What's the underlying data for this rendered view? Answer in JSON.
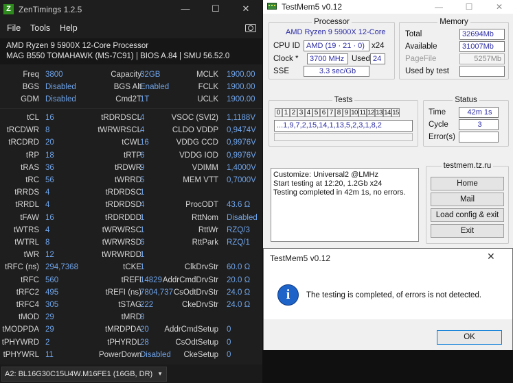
{
  "zentimings": {
    "title": "ZenTimings 1.2.5",
    "logo_letter": "Z",
    "menu": [
      "File",
      "Tools",
      "Help"
    ],
    "cpu": "AMD Ryzen 9 5900X 12-Core Processor",
    "board": "MAG B550 TOMAHAWK (MS-7C91) | BIOS A.84 | SMU 56.52.0",
    "top_rows": [
      {
        "l1": "Freq",
        "v1": "3800",
        "l2": "Capacity",
        "v2": "32GB",
        "l3": "MCLK",
        "v3": "1900.00"
      },
      {
        "l1": "BGS",
        "v1": "Disabled",
        "l2": "BGS Alt",
        "v2": "Enabled",
        "l3": "FCLK",
        "v3": "1900.00"
      },
      {
        "l1": "GDM",
        "v1": "Disabled",
        "l2": "Cmd2T",
        "v2": "1T",
        "l3": "UCLK",
        "v3": "1900.00"
      }
    ],
    "timing_rows": [
      {
        "l1": "tCL",
        "v1": "16",
        "l2": "tRDRDSCL",
        "v2": "4",
        "l3": "VSOC (SVI2)",
        "v3": "1,1188V"
      },
      {
        "l1": "tRCDWR",
        "v1": "8",
        "l2": "tWRWRSCL",
        "v2": "4",
        "l3": "CLDO VDDP",
        "v3": "0,9474V"
      },
      {
        "l1": "tRCDRD",
        "v1": "20",
        "l2": "tCWL",
        "v2": "16",
        "l3": "VDDG CCD",
        "v3": "0,9976V"
      },
      {
        "l1": "tRP",
        "v1": "18",
        "l2": "tRTP",
        "v2": "6",
        "l3": "VDDG IOD",
        "v3": "0,9976V"
      },
      {
        "l1": "tRAS",
        "v1": "36",
        "l2": "tRDWR",
        "v2": "9",
        "l3": "VDIMM",
        "v3": "1,4000V"
      },
      {
        "l1": "tRC",
        "v1": "56",
        "l2": "tWRRD",
        "v2": "5",
        "l3": "MEM VTT",
        "v3": "0,7000V"
      },
      {
        "l1": "tRRDS",
        "v1": "4",
        "l2": "tRDRDSC",
        "v2": "1",
        "l3": "",
        "v3": ""
      },
      {
        "l1": "tRRDL",
        "v1": "4",
        "l2": "tRDRDSD",
        "v2": "4",
        "l3": "ProcODT",
        "v3": "43.6 Ω"
      },
      {
        "l1": "tFAW",
        "v1": "16",
        "l2": "tRDRDDD",
        "v2": "1",
        "l3": "RttNom",
        "v3": "Disabled"
      },
      {
        "l1": "tWTRS",
        "v1": "4",
        "l2": "tWRWRSC",
        "v2": "1",
        "l3": "RttWr",
        "v3": "RZQ/3"
      },
      {
        "l1": "tWTRL",
        "v1": "8",
        "l2": "tWRWRSD",
        "v2": "6",
        "l3": "RttPark",
        "v3": "RZQ/1"
      },
      {
        "l1": "tWR",
        "v1": "12",
        "l2": "tWRWRDD",
        "v2": "1",
        "l3": "",
        "v3": ""
      },
      {
        "l1": "tRFC (ns)",
        "v1": "294,7368",
        "l2": "tCKE",
        "v2": "1",
        "l3": "ClkDrvStr",
        "v3": "60.0 Ω"
      },
      {
        "l1": "tRFC",
        "v1": "560",
        "l2": "tREFI",
        "v2": "14829",
        "l3": "AddrCmdDrvStr",
        "v3": "20.0 Ω"
      },
      {
        "l1": "tRFC2",
        "v1": "495",
        "l2": "tREFI (ns)",
        "v2": "7804,737",
        "l3": "CsOdtDrvStr",
        "v3": "24.0 Ω"
      },
      {
        "l1": "tRFC4",
        "v1": "305",
        "l2": "tSTAG",
        "v2": "222",
        "l3": "CkeDrvStr",
        "v3": "24.0 Ω"
      },
      {
        "l1": "tMOD",
        "v1": "29",
        "l2": "tMRD",
        "v2": "8",
        "l3": "",
        "v3": ""
      },
      {
        "l1": "tMODPDA",
        "v1": "29",
        "l2": "tMRDPDA",
        "v2": "20",
        "l3": "AddrCmdSetup",
        "v3": "0"
      },
      {
        "l1": "tPHYWRD",
        "v1": "2",
        "l2": "tPHYRDL",
        "v2": "28",
        "l3": "CsOdtSetup",
        "v3": "0"
      },
      {
        "l1": "tPHYWRL",
        "v1": "11",
        "l2": "PowerDown",
        "v2": "Disabled",
        "l3": "CkeSetup",
        "v3": "0"
      }
    ],
    "dimm_select": "A2: BL16G30C15U4W.M16FE1 (16GB, DR)"
  },
  "testmem": {
    "title": "TestMem5 v0.12",
    "processor": {
      "legend": "Processor",
      "name": "AMD Ryzen 9 5900X 12-Core",
      "cpu_id_label": "CPU ID",
      "cpu_id_value": "AMD  (19 · 21 · 0)",
      "threads": "x24",
      "clock_label": "Clock *",
      "clock_value": "3700 MHz",
      "used_label": "Used",
      "used_value": "24",
      "sse_label": "SSE",
      "sse_value": "3.3 sec/Gb"
    },
    "memory": {
      "legend": "Memory",
      "total_label": "Total",
      "total_value": "32694Mb",
      "available_label": "Available",
      "available_value": "31007Mb",
      "pagefile_label": "PageFile",
      "pagefile_value": "5257Mb",
      "usedbytest_label": "Used by test",
      "usedbytest_value": ""
    },
    "tests": {
      "legend": "Tests",
      "numbers": [
        "0",
        "1",
        "2",
        "3",
        "4",
        "5",
        "6",
        "7",
        "8",
        "9",
        "10",
        "11",
        "12",
        "13",
        "14",
        "15"
      ],
      "sequence": "...1,9,7,2,15,14,1,13,5,2,3,1,8,2"
    },
    "status": {
      "legend": "Status",
      "time_label": "Time",
      "time_value": "42m 1s",
      "cycle_label": "Cycle",
      "cycle_value": "3",
      "errors_label": "Error(s)",
      "errors_value": ""
    },
    "log": [
      "Customize: Universal2 @LMHz",
      "Start testing at 12:20, 1.2Gb x24",
      "Testing completed in 42m 1s, no errors."
    ],
    "site": {
      "legend": "testmem.tz.ru",
      "home": "Home",
      "mail": "Mail",
      "load": "Load config & exit",
      "exit": "Exit"
    }
  },
  "dialog": {
    "title": "TestMem5 v0.12",
    "close": "✕",
    "info_glyph": "i",
    "message": "The testing is completed, of errors is not detected.",
    "ok": "OK"
  }
}
